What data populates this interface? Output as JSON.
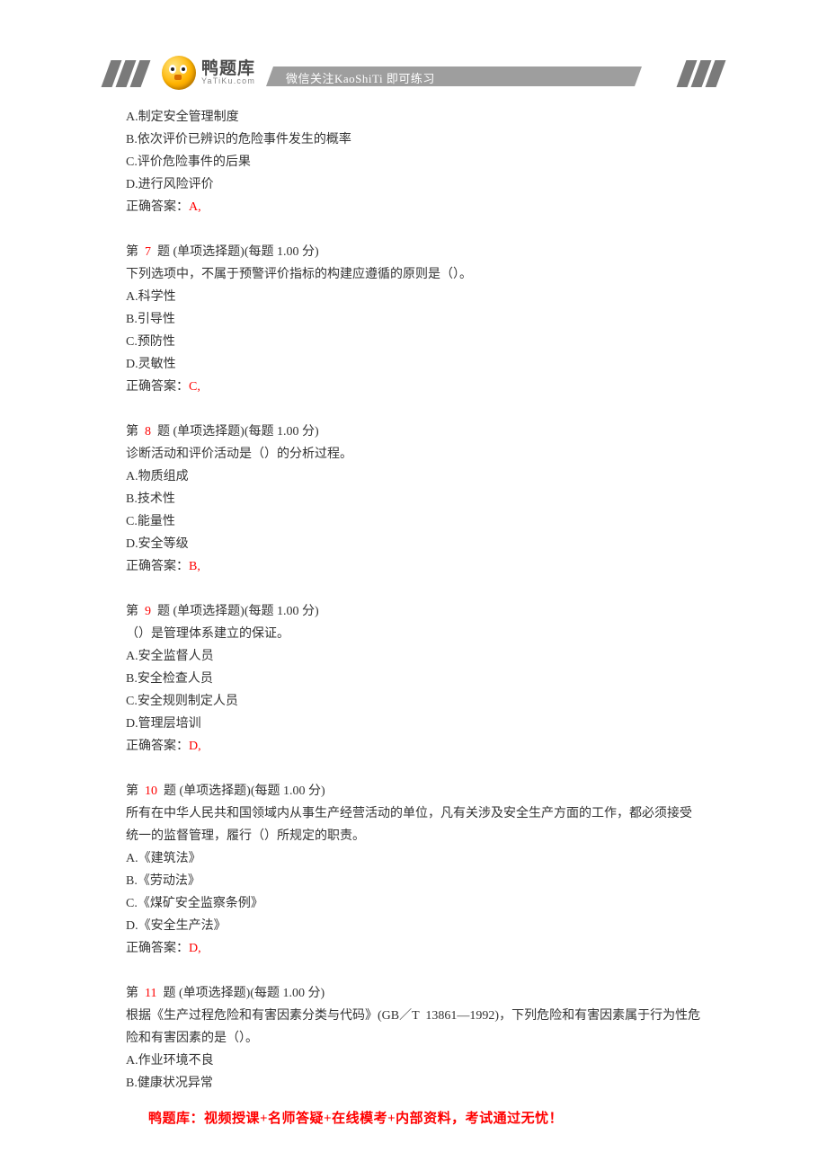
{
  "header": {
    "logo_cn": "鸭题库",
    "logo_en": "YaTiKu.com",
    "banner_text": "微信关注KaoShiTi 即可练习"
  },
  "q6_partial": {
    "optA": "A.制定安全管理制度",
    "optB": "B.依次评价已辨识的危险事件发生的概率",
    "optC": "C.评价危险事件的后果",
    "optD": "D.进行风险评价",
    "ans_label": "正确答案：",
    "ans_value": "A,"
  },
  "q7": {
    "head_before": "第  ",
    "num": "7",
    "head_after": "  题 (单项选择题)(每题 1.00 分)",
    "stem": "下列选项中，不属于预警评价指标的构建应遵循的原则是（）。",
    "optA": "A.科学性",
    "optB": "B.引导性",
    "optC": "C.预防性",
    "optD": "D.灵敏性",
    "ans_label": "正确答案：",
    "ans_value": "C,"
  },
  "q8": {
    "head_before": "第  ",
    "num": "8",
    "head_after": "  题 (单项选择题)(每题 1.00 分)",
    "stem": "诊断活动和评价活动是（）的分析过程。",
    "optA": "A.物质组成",
    "optB": "B.技术性",
    "optC": "C.能量性",
    "optD": "D.安全等级",
    "ans_label": "正确答案：",
    "ans_value": "B,"
  },
  "q9": {
    "head_before": "第  ",
    "num": "9",
    "head_after": "  题 (单项选择题)(每题 1.00 分)",
    "stem": "（）是管理体系建立的保证。",
    "optA": "A.安全监督人员",
    "optB": "B.安全检查人员",
    "optC": "C.安全规则制定人员",
    "optD": "D.管理层培训",
    "ans_label": "正确答案：",
    "ans_value": "D,"
  },
  "q10": {
    "head_before": "第  ",
    "num": "10",
    "head_after": "  题 (单项选择题)(每题 1.00 分)",
    "stem": "所有在中华人民共和国领域内从事生产经营活动的单位，凡有关涉及安全生产方面的工作，都必须接受统一的监督管理，履行（）所规定的职责。",
    "optA": "A.《建筑法》",
    "optB": "B.《劳动法》",
    "optC": "C.《煤矿安全监察条例》",
    "optD": "D.《安全生产法》",
    "ans_label": "正确答案：",
    "ans_value": "D,"
  },
  "q11": {
    "head_before": "第  ",
    "num": "11",
    "head_after": "  题 (单项选择题)(每题 1.00 分)",
    "stem": "根据《生产过程危险和有害因素分类与代码》(GB／T  13861—1992)，下列危险和有害因素属于行为性危险和有害因素的是（）。",
    "optA": "A.作业环境不良",
    "optB": "B.健康状况异常"
  },
  "footer": "鸭题库：视频授课+名师答疑+在线模考+内部资料，考试通过无忧！"
}
